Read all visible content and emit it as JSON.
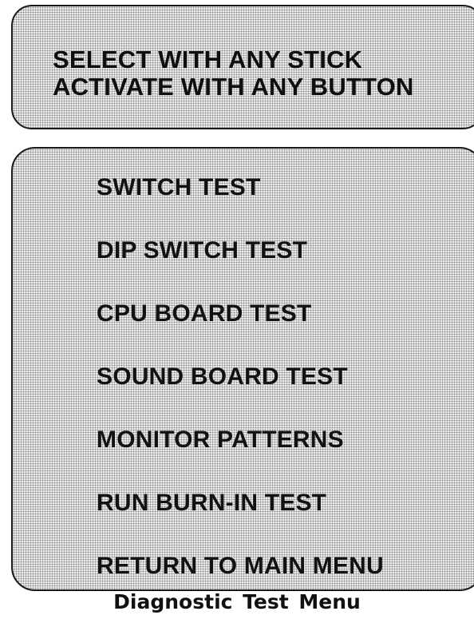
{
  "instructions": {
    "line1": "SELECT WITH ANY STICK",
    "line2": "ACTIVATE WITH ANY BUTTON"
  },
  "menu": {
    "items": [
      {
        "label": "SWITCH TEST"
      },
      {
        "label": "DIP SWITCH TEST"
      },
      {
        "label": "CPU BOARD TEST"
      },
      {
        "label": "SOUND BOARD TEST"
      },
      {
        "label": "MONITOR PATTERNS"
      },
      {
        "label": "RUN BURN-IN TEST"
      },
      {
        "label": "RETURN TO MAIN MENU"
      }
    ]
  },
  "caption": "Diagnostic Test Menu"
}
